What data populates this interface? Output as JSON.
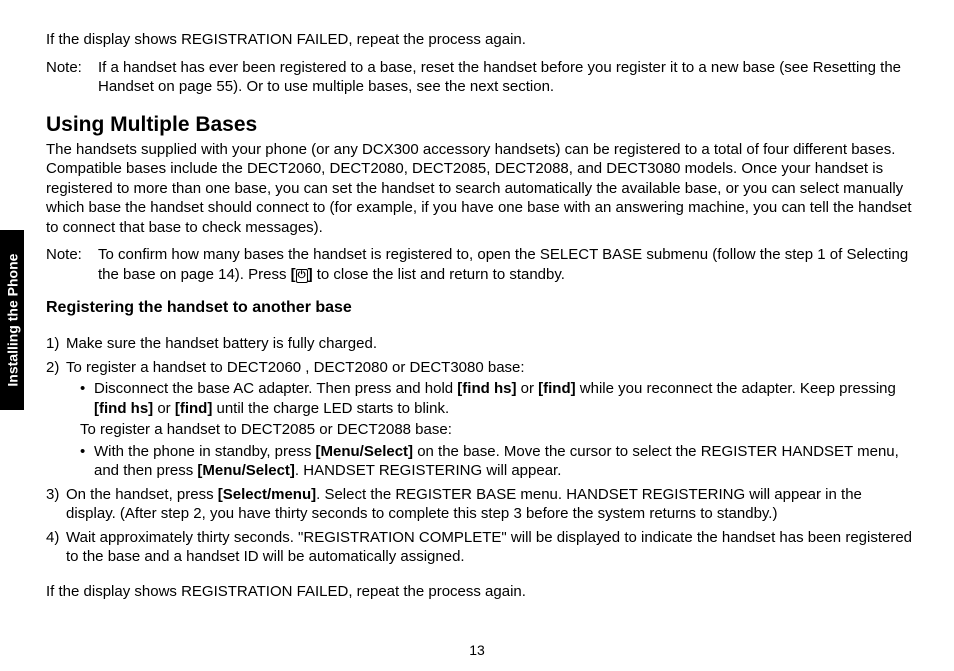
{
  "sideTab": "Installing the Phone",
  "p1": "If the display shows REGISTRATION FAILED, repeat the process again.",
  "note1Label": "Note:",
  "note1Text": "If a handset has ever been registered to a base, reset the handset before you register it to a new base (see Resetting the Handset on page 55). Or to use multiple bases, see the next section.",
  "h2": "Using Multiple Bases",
  "p2": "The handsets supplied with your phone (or any DCX300 accessory handsets) can be registered to a total of four different bases. Compatible bases include the DECT2060, DECT2080, DECT2085, DECT2088, and DECT3080 models. Once your handset is registered to more than one base, you can set the handset to search automatically the available base, or you can select manually which base the handset should connect to (for example, if you have one base with an answering machine, you can tell the handset to connect that base to check messages).",
  "note2Label": "Note:",
  "note2Text_a": "To confirm how many bases the handset is registered to, open the SELECT BASE submenu (follow the step 1 of Selecting the base on page 14). Press ",
  "note2_icon_open": "[",
  "note2_icon_close": "]",
  "note2_icon_glyph": "⏻",
  "note2Text_b": " to close the list and return to standby.",
  "h3": "Registering the handset to another base",
  "li1": "Make sure the handset battery is fully charged.",
  "li2": "To register a handset to DECT2060 , DECT2080 or DECT3080 base:",
  "b1_a": "Disconnect the base AC adapter. Then press and hold ",
  "b1_b1": "[find hs]",
  "b1_c": " or ",
  "b1_b2": "[find]",
  "b1_d": " while you reconnect the adapter. Keep pressing ",
  "b1_b3": "[find hs]",
  "b1_e": " or ",
  "b1_b4": "[find]",
  "b1_f": " until the charge LED starts to blink.",
  "li2mid": "To register a handset to DECT2085 or DECT2088 base:",
  "b2_a": "With the phone in standby, press ",
  "b2_b1": "[Menu/Select]",
  "b2_c": " on the base. Move the cursor to select the REGISTER HANDSET menu, and then press ",
  "b2_b2": "[Menu/Select]",
  "b2_d": ". HANDSET REGISTERING will appear.",
  "li3_a": "On the handset, press ",
  "li3_b1": "[Select/menu]",
  "li3_c": ". Select the REGISTER BASE menu. HANDSET REGISTERING will appear in the display. (After step 2, you have thirty seconds to complete this step 3 before the system returns to standby.)",
  "li4": "Wait approximately thirty seconds. \"REGISTRATION COMPLETE\" will be displayed to indicate the handset has been registered to the base and a handset ID will be automatically assigned.",
  "p3": "If the display shows REGISTRATION FAILED, repeat the process again.",
  "pageNum": "13",
  "num1": "1)",
  "num2": "2)",
  "num3": "3)",
  "num4": "4)"
}
